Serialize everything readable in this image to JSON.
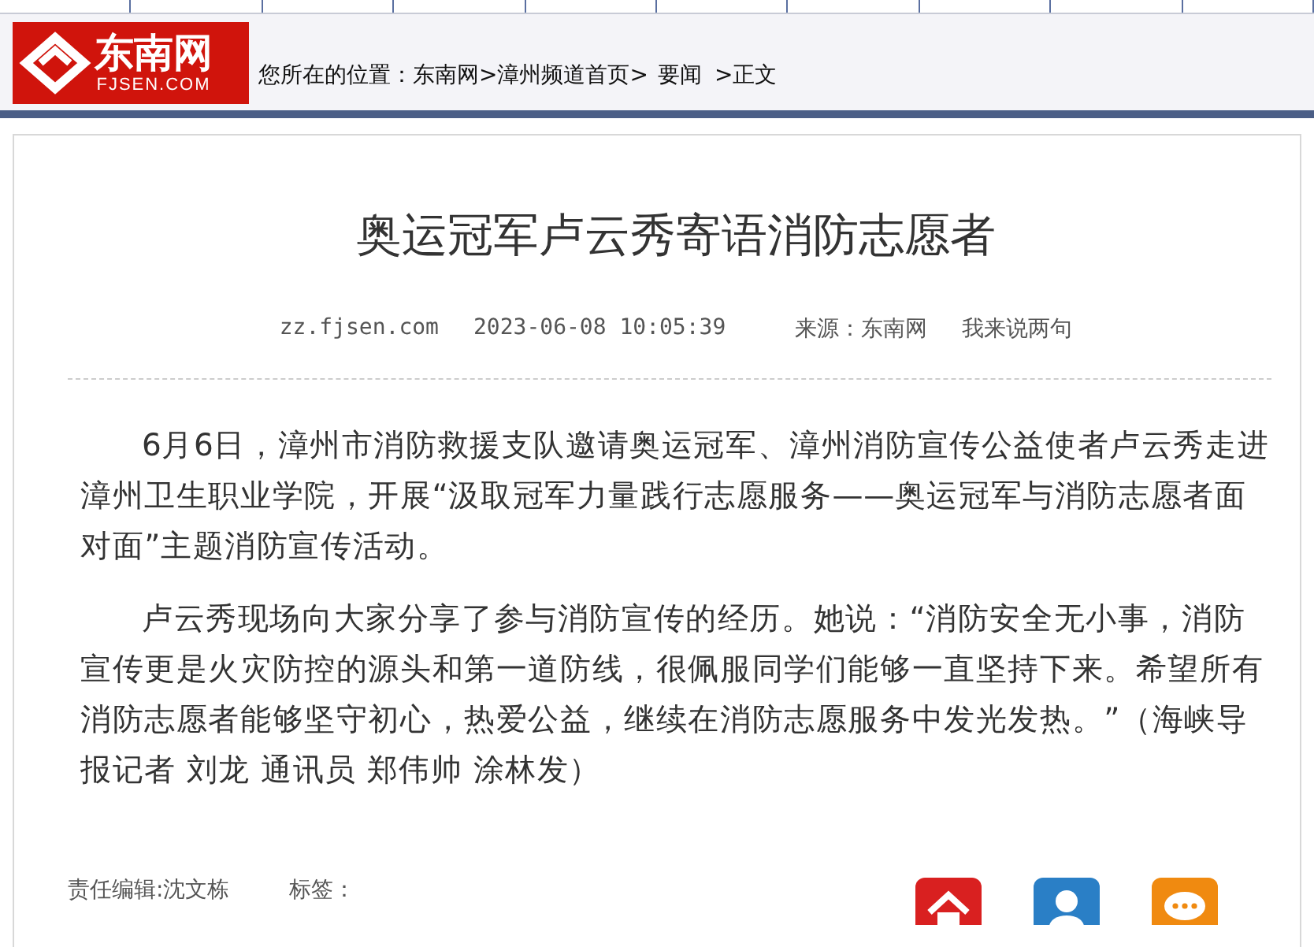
{
  "logo": {
    "name": "东南网",
    "domain": "FJSEN.COM"
  },
  "breadcrumb": {
    "label": "您所在的位置：",
    "items": [
      "东南网",
      ">漳州频道首页>",
      "要闻",
      ">正文"
    ]
  },
  "article": {
    "title": "奥运冠军卢云秀寄语消防志愿者",
    "meta": {
      "site": "zz.fjsen.com",
      "datetime": "2023-06-08 10:05:39",
      "source": "来源：东南网",
      "comment_link": "我来说两句"
    },
    "paragraphs": [
      "6月6日，漳州市消防救援支队邀请奥运冠军、漳州消防宣传公益使者卢云秀走进漳州卫生职业学院，开展“汲取冠军力量践行志愿服务——奥运冠军与消防志愿者面对面”主题消防宣传活动。",
      "卢云秀现场向大家分享了参与消防宣传的经历。她说：“消防安全无小事，消防宣传更是火灾防控的源头和第一道防线，很佩服同学们能够一直坚持下来。希望所有消防志愿者能够坚守初心，热爱公益，继续在消防志愿服务中发光发热。”（海峡导报记者 刘龙 通讯员 郑伟帅 涂林发）"
    ],
    "editor": "责任编辑:沈文栋",
    "tags_label": "标签：",
    "share_buttons": [
      {
        "kind": "home"
      },
      {
        "kind": "person"
      },
      {
        "kind": "chat"
      }
    ]
  }
}
